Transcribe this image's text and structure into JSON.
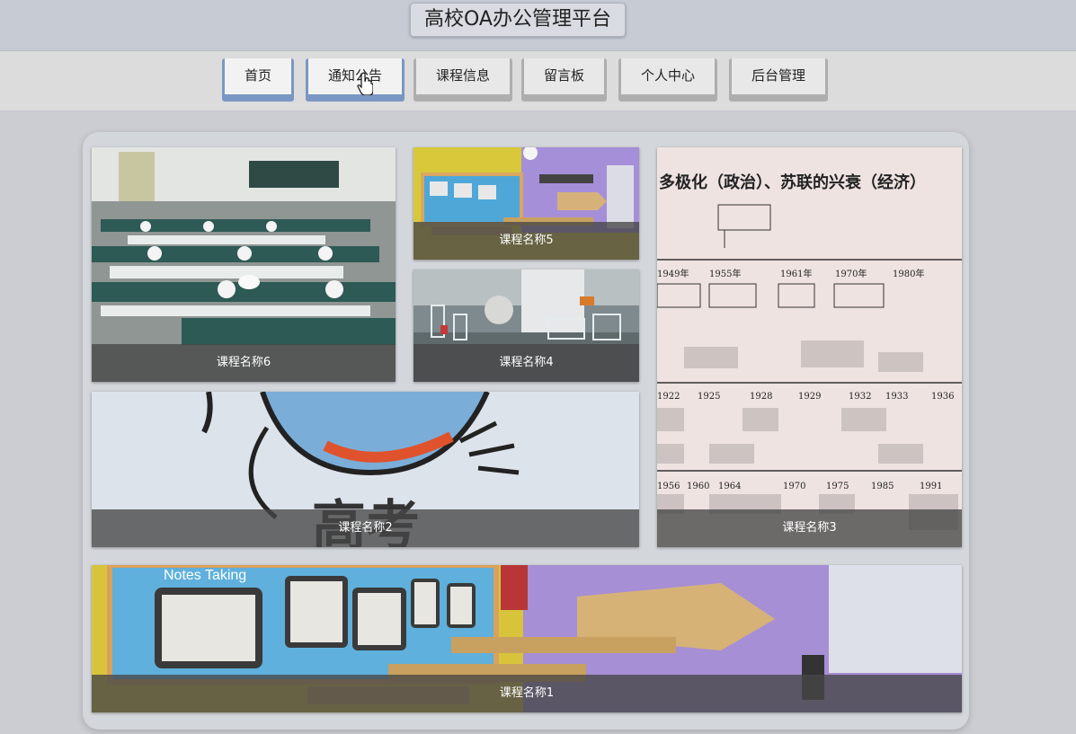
{
  "header": {
    "title": "高校OA办公管理平台"
  },
  "nav": {
    "items": [
      {
        "label": "首页"
      },
      {
        "label": "通知公告"
      },
      {
        "label": "课程信息"
      },
      {
        "label": "留言板"
      },
      {
        "label": "个人中心"
      },
      {
        "label": "后台管理"
      }
    ]
  },
  "courses": [
    {
      "name": "课程名称6"
    },
    {
      "name": "课程名称5"
    },
    {
      "name": "课程名称4"
    },
    {
      "name": "课程名称3"
    },
    {
      "name": "课程名称2"
    },
    {
      "name": "课程名称1"
    }
  ],
  "images": {
    "course6": {
      "subject": "chemistry-lab-photo"
    },
    "course5": {
      "subject": "colorful-classroom-photo"
    },
    "course4": {
      "subject": "lab-glassware-photo"
    },
    "course3": {
      "subject": "history-timeline-scan",
      "heading": "多极化（政治）、苏联的兴衰（经济）",
      "years": [
        "1949年",
        "1955年",
        "1961年",
        "1970年",
        "1980年",
        "1922",
        "1925",
        "1928",
        "1929",
        "1932",
        "1933",
        "1936",
        "1956",
        "1960",
        "1964",
        "1970",
        "1975",
        "1985",
        "1991"
      ]
    },
    "course2": {
      "subject": "cartoon-illustration",
      "text": "高考"
    },
    "course1": {
      "subject": "classroom-wall-photo",
      "text": "Notes Taking"
    }
  },
  "colors": {
    "active_nav": "#7a97c3",
    "inactive_nav": "#aeaeae"
  }
}
